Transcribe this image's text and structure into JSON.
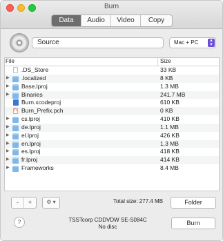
{
  "window": {
    "title": "Burn"
  },
  "tabs": [
    {
      "label": "Data",
      "active": true
    },
    {
      "label": "Audio",
      "active": false
    },
    {
      "label": "Video",
      "active": false
    },
    {
      "label": "Copy",
      "active": false
    }
  ],
  "source": {
    "value": "Source"
  },
  "format": {
    "selected": "Mac + PC"
  },
  "table": {
    "columns": {
      "file": "File",
      "size": "Size"
    },
    "rows": [
      {
        "name": ".DS_Store",
        "size": "33 KB",
        "type": "doc",
        "expandable": false
      },
      {
        "name": ".localized",
        "size": "8 KB",
        "type": "folder",
        "expandable": true
      },
      {
        "name": "Base.lproj",
        "size": "1.3 MB",
        "type": "folder",
        "expandable": true
      },
      {
        "name": "Binaries",
        "size": "241.7 MB",
        "type": "folder",
        "expandable": true
      },
      {
        "name": "Burn.xcodeproj",
        "size": "610 KB",
        "type": "xcode",
        "expandable": false
      },
      {
        "name": "Burn_Prefix.pch",
        "size": "0 KB",
        "type": "header",
        "expandable": false
      },
      {
        "name": "cs.lproj",
        "size": "410 KB",
        "type": "folder",
        "expandable": true
      },
      {
        "name": "de.lproj",
        "size": "1.1 MB",
        "type": "folder",
        "expandable": true
      },
      {
        "name": "el.lproj",
        "size": "426 KB",
        "type": "folder",
        "expandable": true
      },
      {
        "name": "en.lproj",
        "size": "1.3 MB",
        "type": "folder",
        "expandable": true
      },
      {
        "name": "es.lproj",
        "size": "418 KB",
        "type": "folder",
        "expandable": true
      },
      {
        "name": "fr.lproj",
        "size": "414 KB",
        "type": "folder",
        "expandable": true
      },
      {
        "name": "Frameworks",
        "size": "8.4 MB",
        "type": "folder",
        "expandable": true
      }
    ]
  },
  "footer": {
    "remove_label": "-",
    "add_label": "+",
    "gear_label": "⚙ ▾",
    "total_size": "Total size: 277.4 MB",
    "folder_label": "Folder"
  },
  "bottom": {
    "help_label": "?",
    "drive_name": "TSSTcorp CDDVDW SE-S084C",
    "drive_status": "No disc",
    "burn_label": "Burn"
  }
}
